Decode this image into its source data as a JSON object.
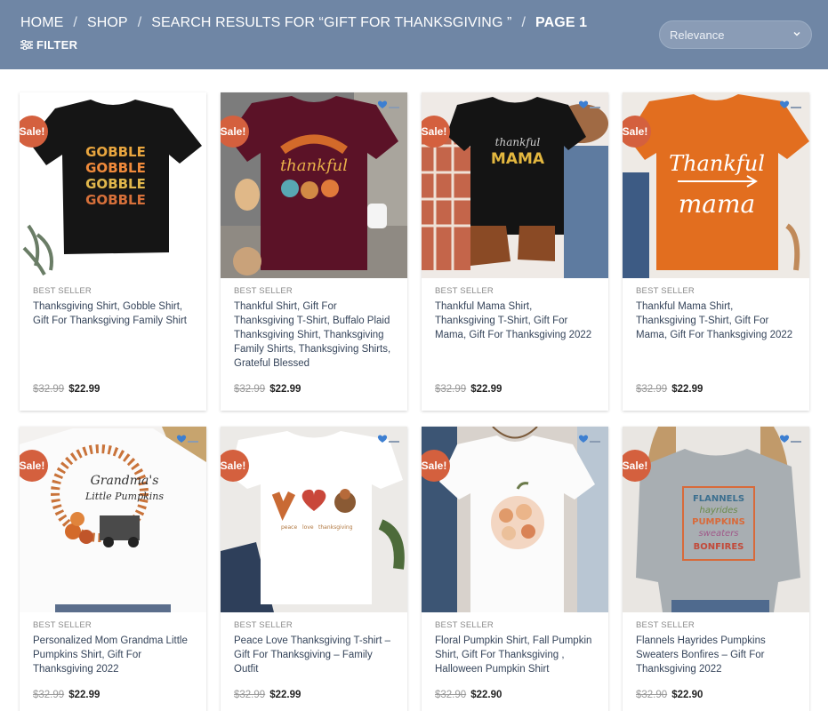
{
  "header": {
    "breadcrumb": [
      "HOME",
      "SHOP",
      "SEARCH RESULTS FOR “GIFT FOR THANKSGIVING ”",
      "PAGE 1"
    ],
    "separator": "/",
    "filter_label": "FILTER",
    "sort": {
      "selected": "Relevance"
    },
    "colors": {
      "background": "#6f86a5",
      "sale_badge": "#d4603e"
    }
  },
  "products": [
    {
      "badge": "Sale!",
      "category": "BEST SELLER",
      "title": "Thanksgiving Shirt, Gobble Shirt, Gift For Thanksgiving Family Shirt",
      "old_price": "$32.99",
      "price": "$22.99",
      "shirt_text": [
        "GOBBLE",
        "GOBBLE",
        "GOBBLE",
        "GOBBLE"
      ]
    },
    {
      "badge": "Sale!",
      "category": "BEST SELLER",
      "title": "Thankful Shirt, Gift For Thanksgiving T-Shirt, Buffalo Plaid Thanksgiving Shirt, Thanksgiving Family Shirts, Thanksgiving Shirts, Grateful Blessed",
      "old_price": "$32.99",
      "price": "$22.99",
      "shirt_text": [
        "thankful"
      ]
    },
    {
      "badge": "Sale!",
      "category": "BEST SELLER",
      "title": "Thankful Mama Shirt, Thanksgiving T-Shirt, Gift For Mama, Gift For Thanksgiving 2022",
      "old_price": "$32.99",
      "price": "$22.99",
      "shirt_text": [
        "thankful",
        "MAMA"
      ]
    },
    {
      "badge": "Sale!",
      "category": "BEST SELLER",
      "title": "Thankful Mama Shirt, Thanksgiving T-Shirt, Gift For Mama, Gift For Thanksgiving 2022",
      "old_price": "$32.99",
      "price": "$22.99",
      "shirt_text": [
        "Thankful",
        "mama"
      ]
    },
    {
      "badge": "Sale!",
      "category": "BEST SELLER",
      "title": "Personalized Mom Grandma Little Pumpkins Shirt, Gift For Thanksgiving 2022",
      "old_price": "$32.99",
      "price": "$22.99",
      "shirt_text": [
        "Grandma's",
        "Little Pumpkins"
      ]
    },
    {
      "badge": "Sale!",
      "category": "BEST SELLER",
      "title": "Peace Love Thanksgiving T-shirt – Gift For Thanksgiving – Family Outfit",
      "old_price": "$32.99",
      "price": "$22.99",
      "shirt_text": [
        "peace",
        "love",
        "thanksgiving"
      ]
    },
    {
      "badge": "Sale!",
      "category": "BEST SELLER",
      "title": "Floral Pumpkin Shirt, Fall Pumpkin Shirt, Gift For Thanksgiving , Halloween Pumpkin Shirt",
      "old_price": "$32.90",
      "price": "$22.90",
      "shirt_text": []
    },
    {
      "badge": "Sale!",
      "category": "BEST SELLER",
      "title": "Flannels Hayrides Pumpkins Sweaters Bonfires – Gift For Thanksgiving 2022",
      "old_price": "$32.90",
      "price": "$22.90",
      "shirt_text": [
        "FLANNELS",
        "hayrides",
        "PUMPKINS",
        "sweaters",
        "BONFIRES"
      ]
    }
  ]
}
